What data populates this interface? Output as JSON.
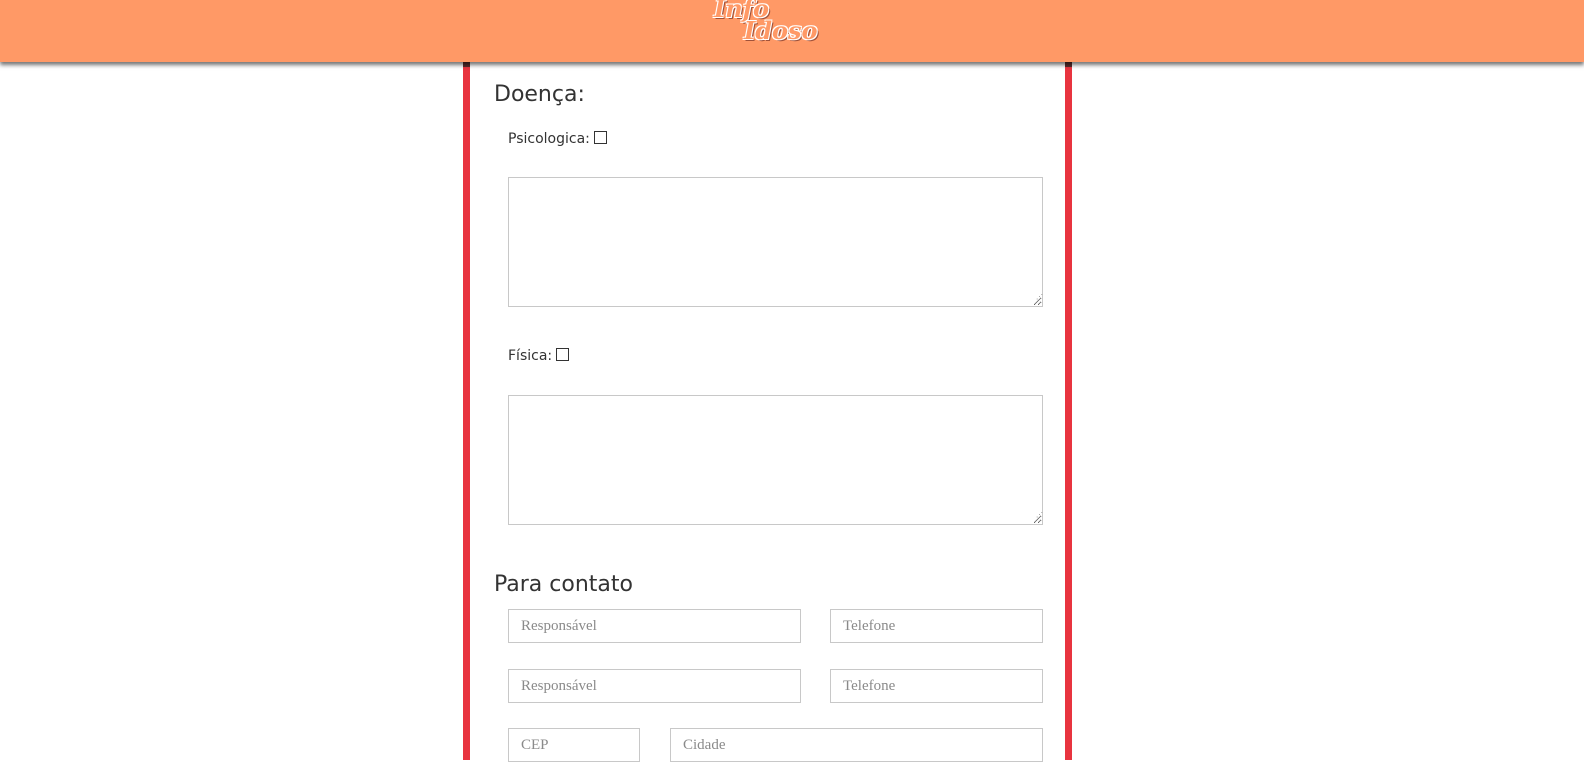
{
  "header": {
    "logo_line1": "Info",
    "logo_line2": "Idoso",
    "background": "#ff9966"
  },
  "form": {
    "border_color": "#e8343f",
    "disease_section": {
      "title": "Doença:",
      "psychological_label": "Psicologica:",
      "psychological_checked": false,
      "physical_label": "Física:",
      "physical_checked": false
    },
    "contact_section": {
      "title": "Para contato",
      "responsible_1_placeholder": "Responsável",
      "phone_1_placeholder": "Telefone",
      "responsible_2_placeholder": "Responsável",
      "phone_2_placeholder": "Telefone",
      "cep_placeholder": "CEP",
      "city_placeholder": "Cidade"
    }
  },
  "icons": {
    "textarea_resize": "resize-grip-icon"
  }
}
